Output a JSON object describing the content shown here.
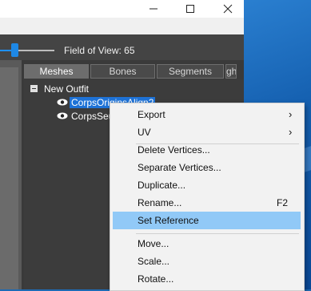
{
  "window": {
    "minimize_icon": "minimize-icon",
    "maximize_icon": "maximize-icon",
    "close_icon": "close-icon"
  },
  "toolbar": {
    "fov_label": "Field of View: 65"
  },
  "tabs": [
    {
      "label": "Meshes",
      "active": true
    },
    {
      "label": "Bones",
      "active": false
    },
    {
      "label": "Segments",
      "active": false
    },
    {
      "label": "gh",
      "active": false
    }
  ],
  "tree": {
    "root_label": "New Outfit",
    "items": [
      {
        "label": "CorpsOriginsAlign2",
        "selected": true
      },
      {
        "label": "CorpsSeu",
        "selected": false
      }
    ]
  },
  "menu": {
    "items": [
      {
        "label": "Export",
        "submenu": true
      },
      {
        "label": "UV",
        "submenu": true
      },
      {
        "label": "Delete Vertices..."
      },
      {
        "label": "Separate Vertices..."
      },
      {
        "label": "Duplicate..."
      },
      {
        "label": "Rename...",
        "shortcut": "F2"
      },
      {
        "label": "Set Reference",
        "highlighted": true
      },
      {
        "label": "Move..."
      },
      {
        "label": "Scale..."
      },
      {
        "label": "Rotate..."
      }
    ],
    "submenu_arrow": "›"
  }
}
